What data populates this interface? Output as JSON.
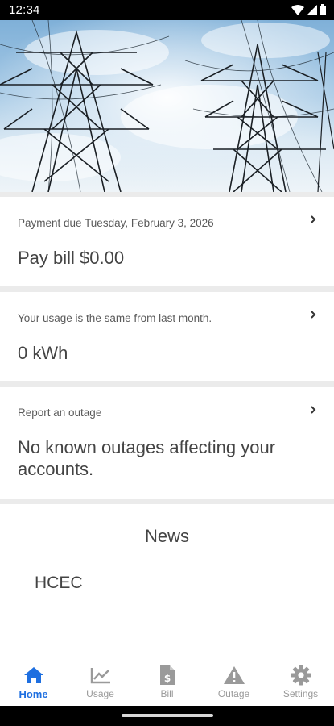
{
  "status_bar": {
    "time": "12:34",
    "icons": [
      "wifi-icon",
      "signal-icon",
      "battery-icon"
    ]
  },
  "hero": {
    "image": "power-transmission-towers-sky"
  },
  "cards": [
    {
      "subtitle": "Payment due Tuesday, February 3, 2026",
      "main": "Pay bill $0.00"
    },
    {
      "subtitle": "Your usage is the same from last month.",
      "main": "0 kWh"
    },
    {
      "subtitle": "Report an outage",
      "main": "No known outages affecting your accounts."
    }
  ],
  "news": {
    "title": "News",
    "items": [
      "HCEC"
    ]
  },
  "tabs": [
    {
      "label": "Home",
      "icon": "home-icon",
      "active": true
    },
    {
      "label": "Usage",
      "icon": "chart-icon",
      "active": false
    },
    {
      "label": "Bill",
      "icon": "bill-icon",
      "active": false
    },
    {
      "label": "Outage",
      "icon": "warning-icon",
      "active": false
    },
    {
      "label": "Settings",
      "icon": "gear-icon",
      "active": false
    }
  ],
  "colors": {
    "accent": "#1e6fe0",
    "inactive": "#9a9a9a",
    "text": "#444444",
    "background": "#ebebeb"
  }
}
